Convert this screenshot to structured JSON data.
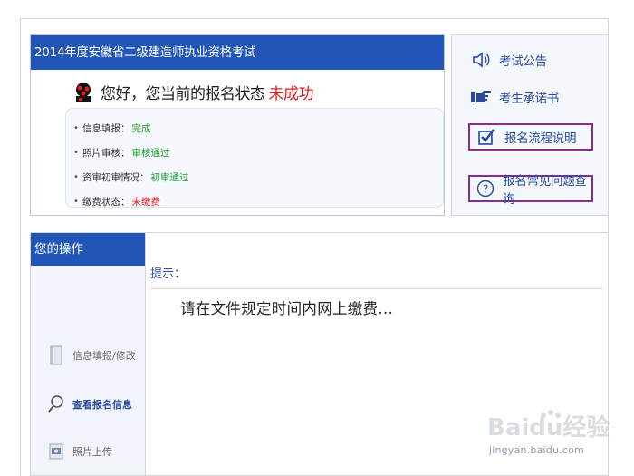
{
  "exam": {
    "title": "2014年度安徽省二级建造师执业资格考试",
    "greeting": "您好，您当前的报名状态",
    "status": "未成功",
    "info": [
      {
        "label": "信息填报：",
        "value": "完成",
        "color": "#1b9e2a"
      },
      {
        "label": "照片审核：",
        "value": "审核通过",
        "color": "#1b9e2a"
      },
      {
        "label": "资审初审情况：",
        "value": "初审通过",
        "color": "#1b9e2a"
      },
      {
        "label": "缴费状态：",
        "value": "未缴费",
        "color": "#e11d1d"
      }
    ]
  },
  "links": [
    {
      "label": "考试公告",
      "icon": "speaker-icon",
      "boxed": false
    },
    {
      "label": "考生承诺书",
      "icon": "pointing-hand-icon",
      "boxed": false
    },
    {
      "label": "报名流程说明",
      "icon": "checkbox-icon",
      "boxed": true
    },
    {
      "label": "报名常见问题查询",
      "icon": "question-circle-icon",
      "boxed": true
    }
  ],
  "operations": {
    "header": "您的操作",
    "items": [
      {
        "label": "信息填报/修改",
        "icon": "document-icon",
        "active": false
      },
      {
        "label": "查看报名信息",
        "icon": "magnifier-icon",
        "active": true
      },
      {
        "label": "照片上传",
        "icon": "photo-upload-icon",
        "active": false
      }
    ]
  },
  "message": {
    "hint_label": "提示：",
    "text": "请在文件规定时间内网上缴费..."
  },
  "watermark": {
    "brand": "Baidu经验",
    "url": "jingyan.baidu.com"
  },
  "colors": {
    "header_blue": "#2255b8",
    "link_blue": "#2a4aa0",
    "status_red": "#e11d1d",
    "ok_green": "#1b9e2a",
    "highlight_purple": "#8a2a8a"
  }
}
